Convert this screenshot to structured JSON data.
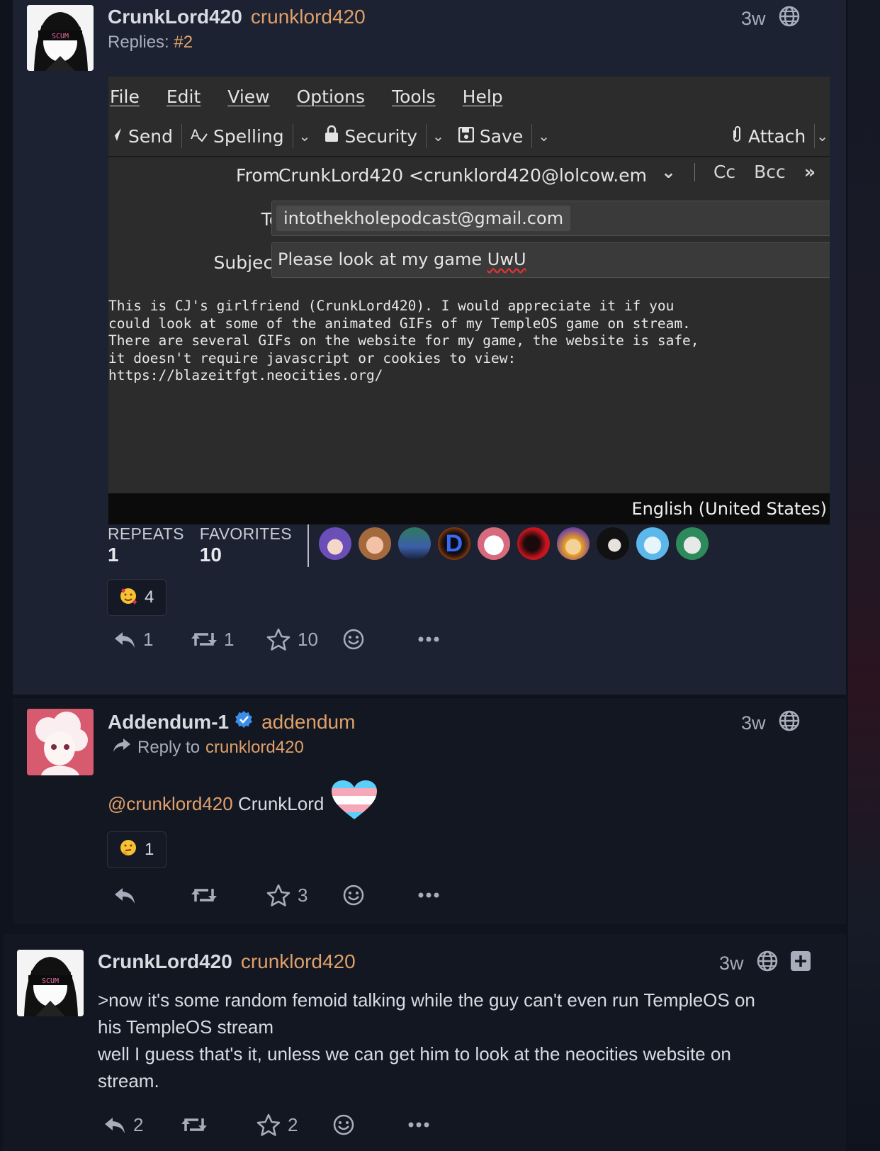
{
  "colors": {
    "accent": "#e0a06a",
    "verified": "#3b8ee8",
    "background": "#0f131d"
  },
  "post1": {
    "display_name": "CrunkLord420",
    "handle": "crunklord420",
    "time": "3w",
    "replies_label": "Replies:",
    "replies_link": "#2",
    "avatar_text": "SCUM",
    "screenshot": {
      "menu": [
        "File",
        "Edit",
        "View",
        "Options",
        "Tools",
        "Help"
      ],
      "toolbar": {
        "send": "Send",
        "spelling": "Spelling",
        "security": "Security",
        "save": "Save",
        "attach": "Attach"
      },
      "from_label": "From",
      "from_value": "CrunkLord420 <crunklord420@lolcow.ema...",
      "cc": "Cc",
      "bcc": "Bcc",
      "to_label": "To",
      "to_value": "intothekholepodcast@gmail.com",
      "subject_label": "Subject",
      "subject_value_plain": "Please look at my game ",
      "subject_value_squig": "UwU",
      "body_lines": [
        "This is CJ's girlfriend (CrunkLord420). I would appreciate it if you",
        "could look at some of the animated GIFs of my TempleOS game on stream.",
        "There are several GIFs on the website for my game, the website is safe,",
        "it doesn't require javascript or cookies to view:",
        "https://blazeitfgt.neocities.org/"
      ],
      "language": "English (United States)"
    },
    "repeats_label": "REPEATS",
    "repeats_count": "1",
    "favorites_label": "FAVORITES",
    "favorites_count": "10",
    "reaction_count": "4",
    "reply_count": "1",
    "boost_count": "1",
    "fav_count": "10"
  },
  "post2": {
    "display_name": "Addendum-1",
    "handle": "addendum",
    "time": "3w",
    "reply_to_label": "Reply to",
    "reply_to_handle": "crunklord420",
    "mention": "@crunklord420",
    "text": " CrunkLord",
    "reaction_count": "1",
    "fav_count": "3"
  },
  "post3": {
    "display_name": "CrunkLord420",
    "handle": "crunklord420",
    "time": "3w",
    "avatar_text": "SCUM",
    "line1": ">now it's some random femoid talking while the guy can't even run TempleOS on",
    "line2": "his TempleOS stream",
    "line3": "well I guess that's it, unless we can get him to look at the neocities website on",
    "line4": "stream.",
    "reply_count": "2",
    "fav_count": "2"
  }
}
